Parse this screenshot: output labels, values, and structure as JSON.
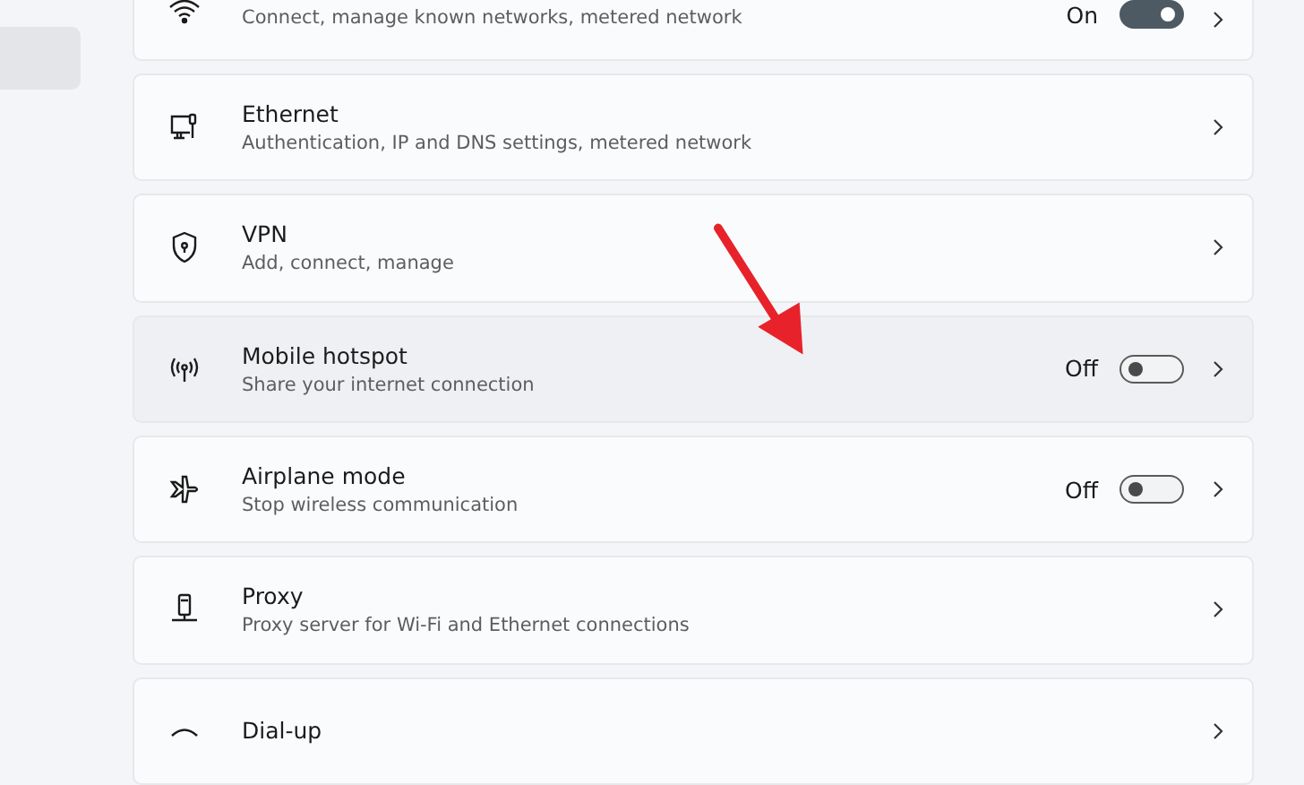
{
  "sidebar": {
    "items": [
      {
        "selected": true
      }
    ]
  },
  "settings": [
    {
      "kind": "wifi",
      "subtitle": "Connect, manage known networks, metered network",
      "toggle": {
        "on": true,
        "label": "On"
      },
      "highlighted": false
    },
    {
      "kind": "ethernet",
      "title": "Ethernet",
      "subtitle": "Authentication, IP and DNS settings, metered network",
      "highlighted": false
    },
    {
      "kind": "vpn",
      "title": "VPN",
      "subtitle": "Add, connect, manage",
      "highlighted": false
    },
    {
      "kind": "hotspot",
      "title": "Mobile hotspot",
      "subtitle": "Share your internet connection",
      "toggle": {
        "on": false,
        "label": "Off"
      },
      "highlighted": true
    },
    {
      "kind": "airplane",
      "title": "Airplane mode",
      "subtitle": "Stop wireless communication",
      "toggle": {
        "on": false,
        "label": "Off"
      },
      "highlighted": false
    },
    {
      "kind": "proxy",
      "title": "Proxy",
      "subtitle": "Proxy server for Wi-Fi and Ethernet connections",
      "highlighted": false
    },
    {
      "kind": "dialup",
      "title": "Dial-up",
      "highlighted": false
    }
  ]
}
